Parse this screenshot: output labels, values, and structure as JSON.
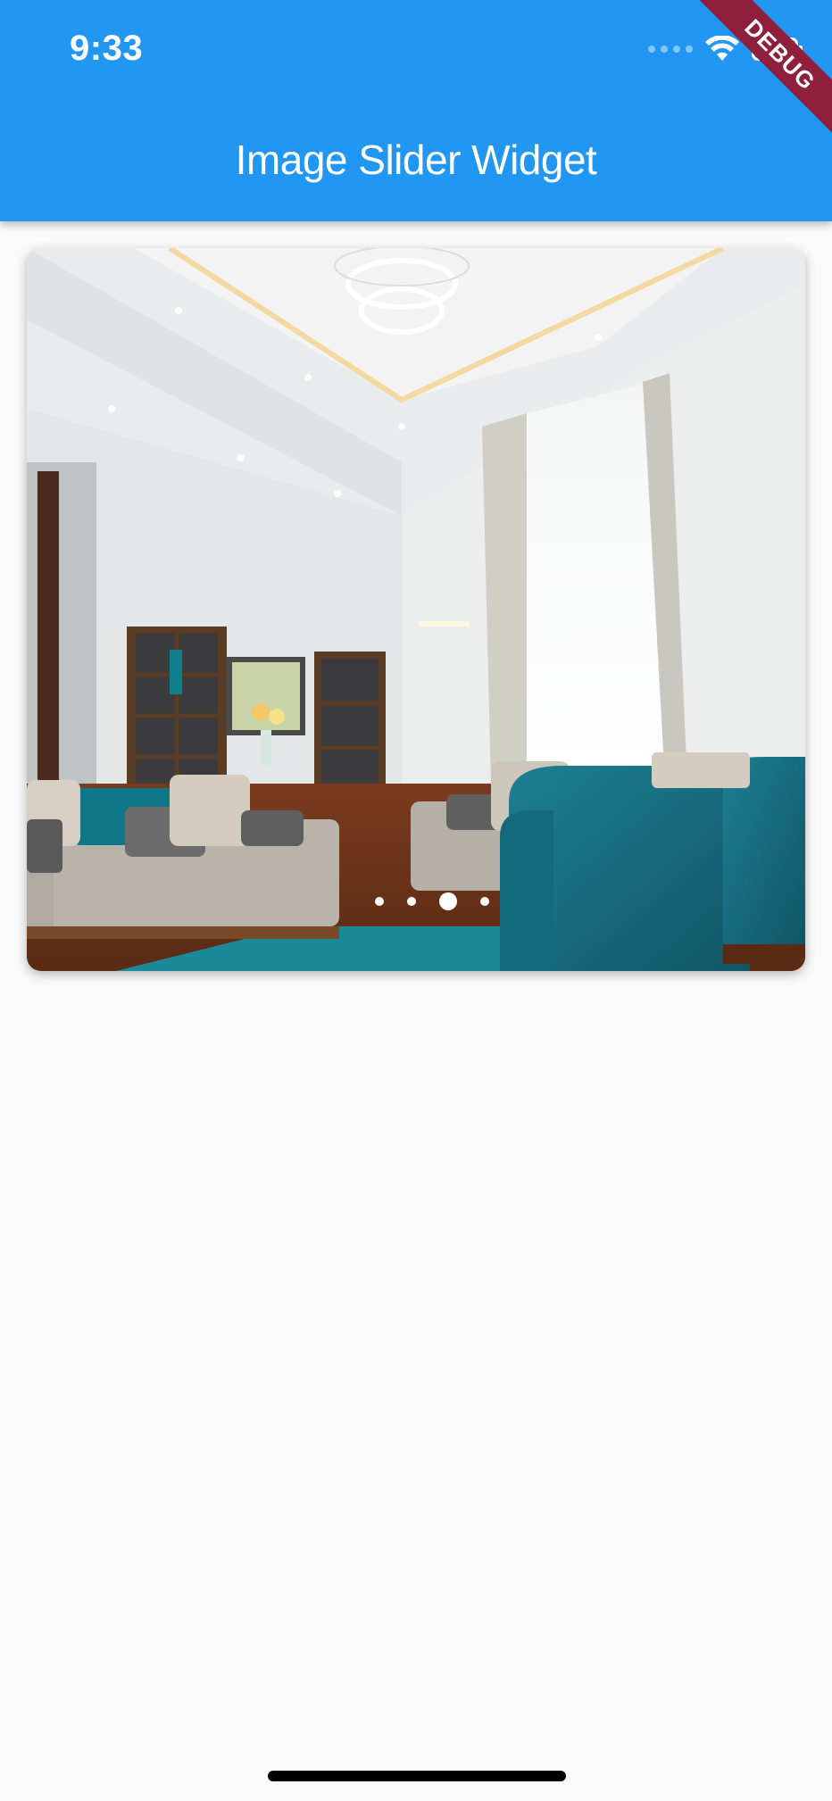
{
  "status_bar": {
    "time": "9:33"
  },
  "app_bar": {
    "title": "Image Slider Widget",
    "color": "#2196f3"
  },
  "debug_banner": {
    "label": "DEBUG",
    "color": "#8e1f3d"
  },
  "slider": {
    "current_image": "living-room-interior",
    "page_count": 4,
    "active_index": 2
  },
  "icons": [
    "wifi-icon",
    "battery-icon",
    "signal-icon"
  ]
}
